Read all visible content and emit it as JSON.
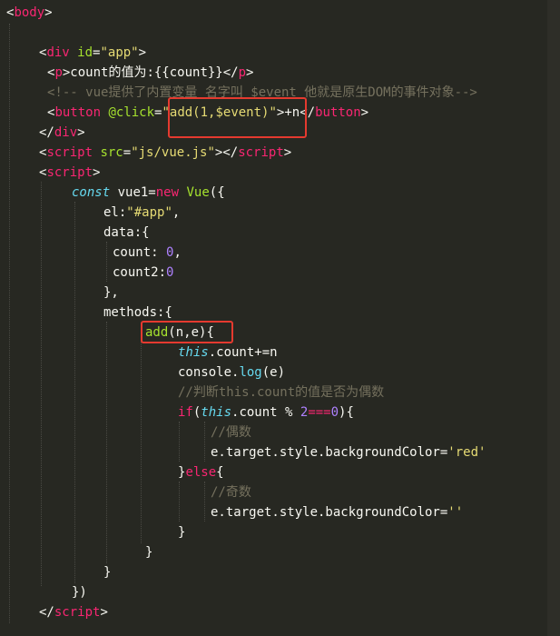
{
  "editor": {
    "theme": "monokai",
    "background": "#272822",
    "highlight_color": "#e53a2f"
  },
  "lines": [
    [
      {
        "t": "<",
        "c": "tk-text"
      },
      {
        "t": "body",
        "c": "tk-tag"
      },
      {
        "t": ">",
        "c": "tk-text"
      }
    ],
    [],
    [
      {
        "t": "<",
        "c": "tk-text"
      },
      {
        "t": "div",
        "c": "tk-tag"
      },
      {
        "t": " ",
        "c": "tk-text"
      },
      {
        "t": "id",
        "c": "tk-attr"
      },
      {
        "t": "=",
        "c": "tk-text"
      },
      {
        "t": "\"app\"",
        "c": "tk-str"
      },
      {
        "t": ">",
        "c": "tk-text"
      }
    ],
    [
      {
        "t": "<",
        "c": "tk-text"
      },
      {
        "t": "p",
        "c": "tk-tag"
      },
      {
        "t": ">count的值为:{{count}}</",
        "c": "tk-text"
      },
      {
        "t": "p",
        "c": "tk-tag"
      },
      {
        "t": ">",
        "c": "tk-text"
      }
    ],
    [
      {
        "t": "<!-- vue提供了内置变量 名字叫 $event 他就是原生DOM的事件对象-->",
        "c": "tk-comment"
      }
    ],
    [
      {
        "t": "<",
        "c": "tk-text"
      },
      {
        "t": "button",
        "c": "tk-tag"
      },
      {
        "t": " ",
        "c": "tk-text"
      },
      {
        "t": "@click",
        "c": "tk-attr"
      },
      {
        "t": "=",
        "c": "tk-text"
      },
      {
        "t": "\"add(1,$event)\"",
        "c": "tk-str"
      },
      {
        "t": ">+n</",
        "c": "tk-text"
      },
      {
        "t": "button",
        "c": "tk-tag"
      },
      {
        "t": ">",
        "c": "tk-text"
      }
    ],
    [
      {
        "t": "</",
        "c": "tk-text"
      },
      {
        "t": "div",
        "c": "tk-tag"
      },
      {
        "t": ">",
        "c": "tk-text"
      }
    ],
    [
      {
        "t": "<",
        "c": "tk-text"
      },
      {
        "t": "script",
        "c": "tk-tag"
      },
      {
        "t": " ",
        "c": "tk-text"
      },
      {
        "t": "src",
        "c": "tk-attr"
      },
      {
        "t": "=",
        "c": "tk-text"
      },
      {
        "t": "\"js/vue.js\"",
        "c": "tk-str"
      },
      {
        "t": "></",
        "c": "tk-text"
      },
      {
        "t": "script",
        "c": "tk-tag"
      },
      {
        "t": ">",
        "c": "tk-text"
      }
    ],
    [
      {
        "t": "<",
        "c": "tk-text"
      },
      {
        "t": "script",
        "c": "tk-tag"
      },
      {
        "t": ">",
        "c": "tk-text"
      }
    ],
    [
      {
        "t": "const",
        "c": "tk-storage"
      },
      {
        "t": " vue1=",
        "c": "tk-text"
      },
      {
        "t": "new",
        "c": "tk-kw"
      },
      {
        "t": " ",
        "c": "tk-text"
      },
      {
        "t": "Vue",
        "c": "tk-class"
      },
      {
        "t": "({",
        "c": "tk-text"
      }
    ],
    [
      {
        "t": "el:",
        "c": "tk-text"
      },
      {
        "t": "\"#app\"",
        "c": "tk-str"
      },
      {
        "t": ",",
        "c": "tk-text"
      }
    ],
    [
      {
        "t": "data:{",
        "c": "tk-text"
      }
    ],
    [
      {
        "t": "count: ",
        "c": "tk-text"
      },
      {
        "t": "0",
        "c": "tk-num"
      },
      {
        "t": ",",
        "c": "tk-text"
      }
    ],
    [
      {
        "t": "count2:",
        "c": "tk-text"
      },
      {
        "t": "0",
        "c": "tk-num"
      }
    ],
    [
      {
        "t": "},",
        "c": "tk-text"
      }
    ],
    [
      {
        "t": "methods:{",
        "c": "tk-text"
      }
    ],
    [
      {
        "t": "add",
        "c": "tk-fn"
      },
      {
        "t": "(n,e){",
        "c": "tk-text"
      }
    ],
    [
      {
        "t": "this",
        "c": "tk-this"
      },
      {
        "t": ".count+=n",
        "c": "tk-text"
      }
    ],
    [
      {
        "t": "console",
        "c": "tk-text"
      },
      {
        "t": ".",
        "c": "tk-text"
      },
      {
        "t": "log",
        "c": "tk-builtin"
      },
      {
        "t": "(e)",
        "c": "tk-text"
      }
    ],
    [
      {
        "t": "//判断this.count的值是否为偶数",
        "c": "tk-comment"
      }
    ],
    [
      {
        "t": "if",
        "c": "tk-kw"
      },
      {
        "t": "(",
        "c": "tk-text"
      },
      {
        "t": "this",
        "c": "tk-this"
      },
      {
        "t": ".count % ",
        "c": "tk-text"
      },
      {
        "t": "2",
        "c": "tk-num"
      },
      {
        "t": "===",
        "c": "tk-kw"
      },
      {
        "t": "0",
        "c": "tk-num"
      },
      {
        "t": "){",
        "c": "tk-text"
      }
    ],
    [
      {
        "t": "//偶数",
        "c": "tk-comment"
      }
    ],
    [
      {
        "t": "e.target.style.backgroundColor=",
        "c": "tk-text"
      },
      {
        "t": "'red'",
        "c": "tk-str"
      }
    ],
    [
      {
        "t": "}",
        "c": "tk-text"
      },
      {
        "t": "else",
        "c": "tk-kw"
      },
      {
        "t": "{",
        "c": "tk-text"
      }
    ],
    [
      {
        "t": "//奇数",
        "c": "tk-comment"
      }
    ],
    [
      {
        "t": "e.target.style.backgroundColor=",
        "c": "tk-text"
      },
      {
        "t": "''",
        "c": "tk-str"
      }
    ],
    [
      {
        "t": "}",
        "c": "tk-text"
      }
    ],
    [
      {
        "t": "}",
        "c": "tk-text"
      }
    ],
    [
      {
        "t": "}",
        "c": "tk-text"
      }
    ],
    [
      {
        "t": "})",
        "c": "tk-text"
      }
    ],
    [
      {
        "t": "</",
        "c": "tk-text"
      },
      {
        "t": "script",
        "c": "tk-tag"
      },
      {
        "t": ">",
        "c": "tk-text"
      }
    ]
  ]
}
